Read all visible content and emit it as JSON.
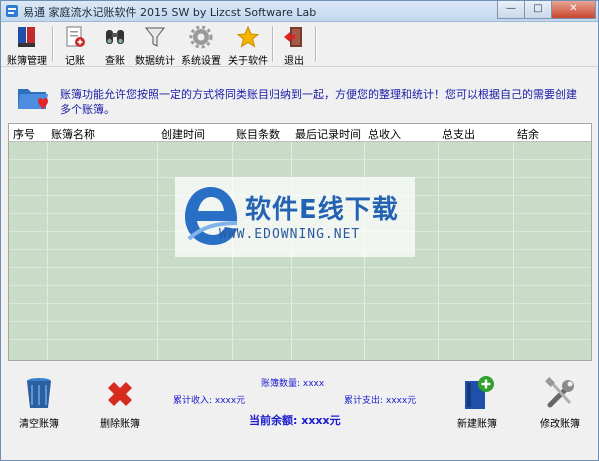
{
  "window": {
    "title": "易通 家庭流水记账软件 2015  SW    by Lizcst Software Lab",
    "controls": {
      "minimize": "—",
      "maximize": "□",
      "close": "✕"
    }
  },
  "toolbar": {
    "buttons": [
      {
        "label": "账簿管理",
        "icon": "ledger-icon"
      },
      {
        "label": "记账",
        "icon": "record-icon"
      },
      {
        "label": "查账",
        "icon": "binoculars-icon"
      },
      {
        "label": "数据统计",
        "icon": "funnel-icon"
      },
      {
        "label": "系统设置",
        "icon": "gear-icon"
      },
      {
        "label": "关于软件",
        "icon": "star-icon"
      },
      {
        "label": "退出",
        "icon": "exit-door-icon"
      }
    ]
  },
  "info": {
    "text": "账簿功能允许您按照一定的方式将同类账目归纳到一起，方便您的整理和统计！您可以根据自己的需要创建多个账簿。"
  },
  "table": {
    "columns": [
      "序号",
      "账簿名称",
      "创建时间",
      "账目条数",
      "最后记录时间",
      "总收入",
      "总支出",
      "结余"
    ],
    "rows": []
  },
  "watermark": {
    "title": "软件E线下载",
    "url": "WWW.EDOWNING.NET"
  },
  "bottom": {
    "clear_label": "清空账簿",
    "delete_label": "删除账簿",
    "new_label": "新建账簿",
    "edit_label": "修改账簿",
    "ledger_count": "账簿数量: xxxx",
    "total_income": "累计收入: xxxx元",
    "total_expense": "累计支出: xxxx元",
    "balance": "当前余额: xxxx元"
  },
  "colors": {
    "accent_blue": "#1a1ad0",
    "grid_green": "#c8dcc7",
    "delete_red": "#d62b1e",
    "new_green": "#2fa12f"
  }
}
